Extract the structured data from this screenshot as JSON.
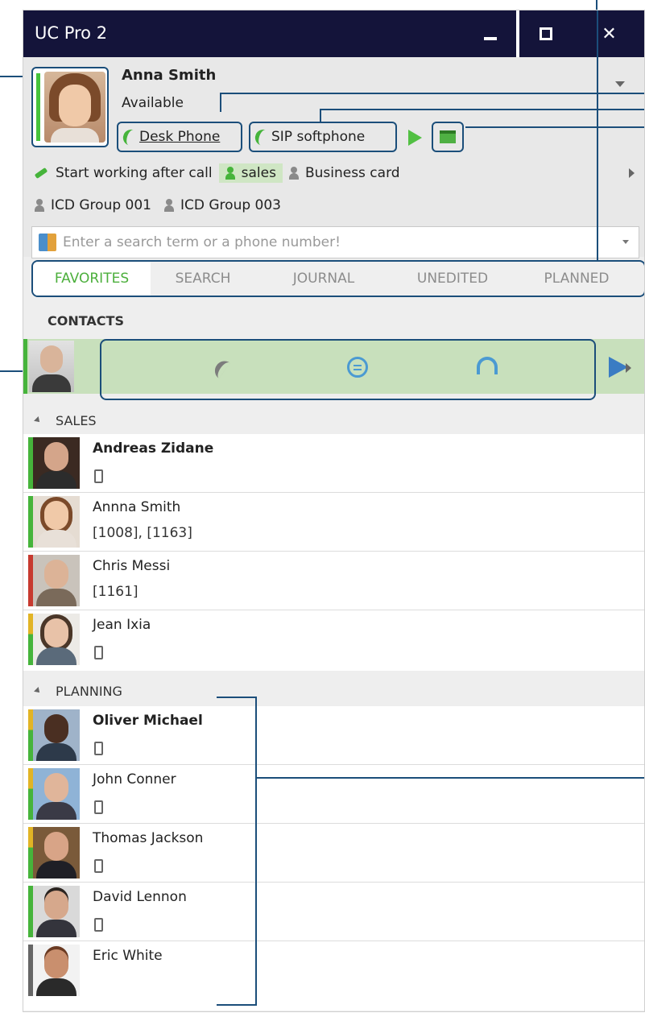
{
  "window": {
    "title": "UC Pro 2"
  },
  "profile": {
    "name": "Anna Smith",
    "status": "Available",
    "devices": [
      {
        "label": "Desk Phone"
      },
      {
        "label": "SIP softphone"
      }
    ],
    "row3": {
      "after_call": "Start working after call",
      "group_sales": "sales",
      "business_card": "Business card"
    },
    "row4": {
      "group1": "ICD Group 001",
      "group2": "ICD Group 003"
    }
  },
  "search": {
    "placeholder": "Enter a search term or a phone number!"
  },
  "tabs": [
    {
      "label": "FAVORITES",
      "active": true
    },
    {
      "label": "SEARCH"
    },
    {
      "label": "JOURNAL"
    },
    {
      "label": "UNEDITED"
    },
    {
      "label": "PLANNED"
    }
  ],
  "contacts_header": "CONTACTS",
  "groups": [
    {
      "name": "SALES",
      "items": [
        {
          "name": "Andreas Zidane",
          "sub": "",
          "phone_icon": true,
          "status_color": "#46b43b"
        },
        {
          "name": "Annna Smith",
          "sub": "[1008], [1163]",
          "phone_icon": false,
          "status_color": "#46b43b"
        },
        {
          "name": "Chris Messi",
          "sub": "[1161]",
          "phone_icon": false,
          "status_color": "#c73a2f"
        },
        {
          "name": "Jean Ixia",
          "sub": "",
          "phone_icon": true,
          "status_color": "#e2b425"
        }
      ]
    },
    {
      "name": "PLANNING",
      "items": [
        {
          "name": "Oliver Michael",
          "sub": "",
          "phone_icon": true,
          "status_color": "#e2b425"
        },
        {
          "name": "John Conner",
          "sub": "",
          "phone_icon": true,
          "status_color": "#e2b425"
        },
        {
          "name": "Thomas Jackson",
          "sub": "",
          "phone_icon": true,
          "status_color": "#e2b425"
        },
        {
          "name": "David Lennon",
          "sub": "",
          "phone_icon": true,
          "status_color": "#46b43b"
        },
        {
          "name": "Eric White",
          "sub": "",
          "phone_icon": false,
          "status_color": "#666666"
        }
      ]
    }
  ],
  "colors": {
    "titlebar": "#14143a",
    "accent_green": "#46b43b",
    "callout_blue": "#1b4e7a",
    "active_tab": "#4caf3c"
  },
  "icons": [
    "minimize-icon",
    "maximize-icon",
    "close-icon",
    "handset-icon",
    "play-icon",
    "calendar-icon",
    "pencil-icon",
    "person-icon",
    "address-book-icon",
    "call-icon",
    "chat-icon",
    "headset-icon",
    "device-phone-icon"
  ]
}
